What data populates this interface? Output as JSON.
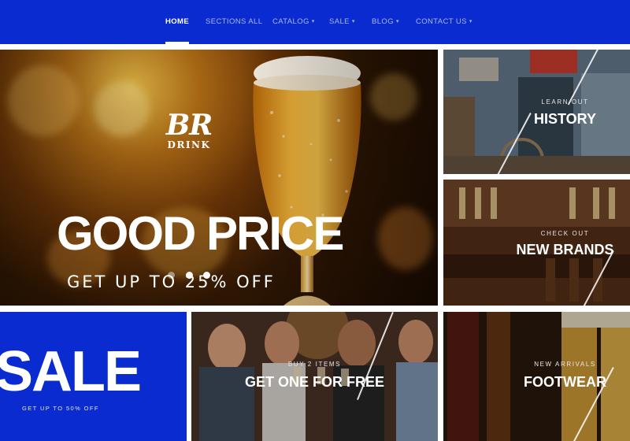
{
  "nav": {
    "items": [
      {
        "label": "HOME",
        "has_caret": false,
        "active": true
      },
      {
        "label": "SECTIONS ALL",
        "has_caret": false,
        "active": false
      },
      {
        "label": "CATALOG",
        "has_caret": true,
        "active": false
      },
      {
        "label": "SALE",
        "has_caret": true,
        "active": false
      },
      {
        "label": "BLOG",
        "has_caret": true,
        "active": false
      },
      {
        "label": "CONTACT US",
        "has_caret": true,
        "active": false
      }
    ],
    "caret_icon": "chevron-down-icon"
  },
  "hero": {
    "logo_mark": "BR",
    "logo_word": "DRINK",
    "title": "GOOD PRICE",
    "subtitle": "GET UP TO 25% OFF",
    "slides_count": 3,
    "active_slide": 1
  },
  "banners": {
    "history": {
      "kicker": "LEARN OUT",
      "title": "HISTORY"
    },
    "brands": {
      "kicker": "CHECK OUT",
      "title": "NEW BRANDS"
    },
    "sale": {
      "title": "SALE",
      "subtitle": "GET UP TO 50% OFF"
    },
    "free": {
      "kicker": "BUY 2 ITEMS",
      "title": "GET ONE FOR FREE"
    },
    "footwear": {
      "kicker": "NEW ARRIVALS",
      "title": "FOOTWEAR"
    }
  },
  "colors": {
    "brand_blue": "#0a2bd0",
    "nav_inactive": "#aab8f5",
    "white": "#ffffff"
  }
}
